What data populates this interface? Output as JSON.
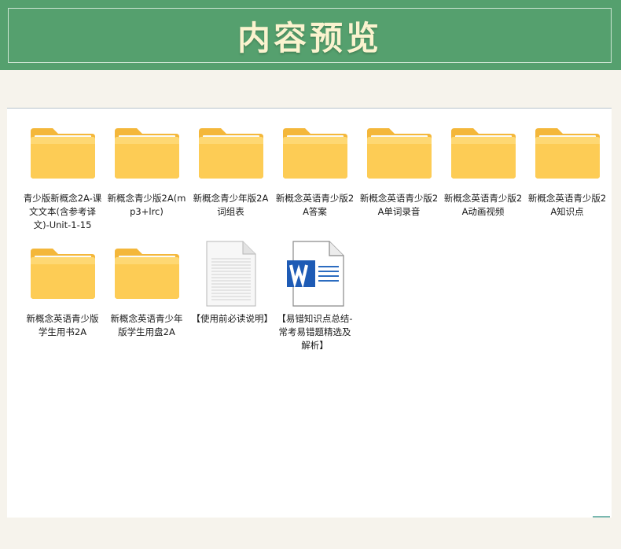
{
  "header": {
    "title": "内容预览"
  },
  "files": [
    {
      "name": "青少版新概念2A-课文文本(含参考译文)-Unit-1-15",
      "icon": "folder-icon"
    },
    {
      "name": "新概念青少版2A(mp3+lrc)",
      "icon": "folder-icon"
    },
    {
      "name": "新概念青少年版2A词组表",
      "icon": "folder-icon"
    },
    {
      "name": "新概念英语青少版2A答案",
      "icon": "folder-icon"
    },
    {
      "name": "新概念英语青少版2A单词录音",
      "icon": "folder-icon"
    },
    {
      "name": "新概念英语青少版2A动画视频",
      "icon": "folder-icon"
    },
    {
      "name": "新概念英语青少版2A知识点",
      "icon": "folder-icon"
    },
    {
      "name": "新概念英语青少版学生用书2A",
      "icon": "folder-icon"
    },
    {
      "name": "新概念英语青少年版学生用盘2A",
      "icon": "folder-icon"
    },
    {
      "name": "【使用前必读说明】",
      "icon": "text-document-icon"
    },
    {
      "name": "【易错知识点总结-常考易错题精选及解析】",
      "icon": "word-document-icon"
    }
  ]
}
